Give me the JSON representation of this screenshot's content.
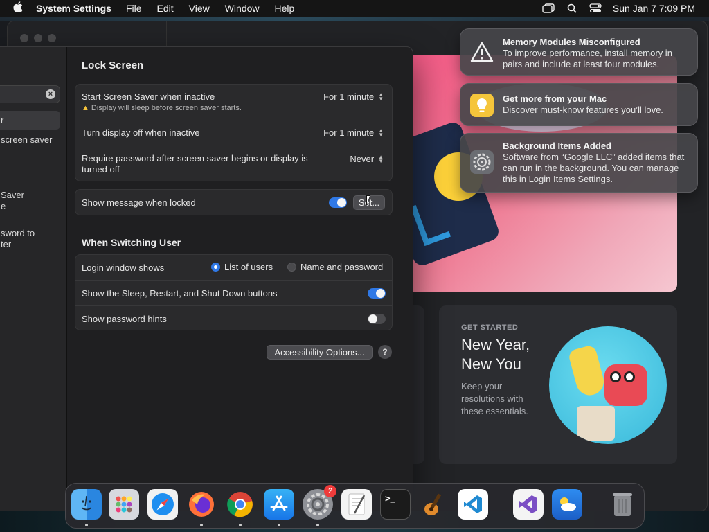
{
  "menubar": {
    "app": "System Settings",
    "items": [
      "File",
      "Edit",
      "View",
      "Window",
      "Help"
    ],
    "clock": "Sun Jan 7  7:09 PM"
  },
  "sidebar": {
    "fragments": [
      "r",
      "screen saver",
      "Saver",
      "e",
      "sword to",
      "ter"
    ]
  },
  "lock_screen": {
    "title": "Lock Screen",
    "screen_saver_label": "Start Screen Saver when inactive",
    "screen_saver_value": "For 1 minute",
    "screen_saver_warning": "Display will sleep before screen saver starts.",
    "display_off_label": "Turn display off when inactive",
    "display_off_value": "For 1 minute",
    "require_password_label_1": "Require password after screen saver begins or display is",
    "require_password_label_2": "turned off",
    "require_password_value": "Never",
    "show_message_label": "Show message when locked",
    "show_message_on": true,
    "set_button": "Set..."
  },
  "switching_user": {
    "title": "When Switching User",
    "login_window_label": "Login window shows",
    "option_list": "List of users",
    "option_name": "Name and password",
    "selected": "List of users",
    "sleep_buttons_label": "Show the Sleep, Restart, and Shut Down buttons",
    "sleep_buttons_on": true,
    "password_hints_label": "Show password hints",
    "password_hints_on": false
  },
  "accessibility_button": "Accessibility Options...",
  "help_button": "?",
  "promo": {
    "kicker": "GET STARTED",
    "title": "New Year, New You",
    "body": "Keep your resolutions with these essentials."
  },
  "notifications": [
    {
      "title": "Memory Modules Misconfigured",
      "body": "To improve performance, install memory in pairs and include at least four modules.",
      "icon": "warning-icon"
    },
    {
      "title": "Get more from your Mac",
      "body": "Discover must-know features you’ll love.",
      "icon": "tips-icon"
    },
    {
      "title": "Background Items Added",
      "body": "Software from “Google LLC” added items that can run in the background. You can manage this in Login Items Settings.",
      "icon": "gear-icon"
    }
  ],
  "dock": {
    "settings_badge": "2",
    "terminal_glyph": ">_",
    "apps": [
      "finder",
      "launchpad",
      "safari",
      "firefox",
      "chrome",
      "app-store",
      "system-settings",
      "textedit",
      "terminal",
      "garageband",
      "vscode",
      "visual-studio",
      "weather",
      "trash"
    ]
  },
  "colors": {
    "accent": "#2f78e6",
    "badge": "#ef3b3b",
    "warning": "#f5c33b"
  }
}
